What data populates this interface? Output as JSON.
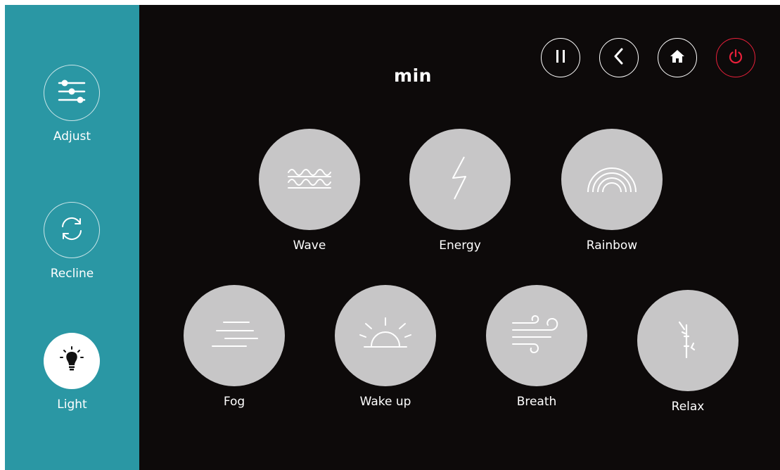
{
  "sidebar": {
    "items": [
      {
        "label": "Adjust",
        "icon": "sliders-icon",
        "active": false
      },
      {
        "label": "Recline",
        "icon": "rotate-arrows-icon",
        "active": false
      },
      {
        "label": "Light",
        "icon": "lightbulb-icon",
        "active": true
      }
    ]
  },
  "header": {
    "title": "min",
    "controls": [
      "pause-icon",
      "back-icon",
      "home-icon",
      "power-icon"
    ]
  },
  "modes": [
    {
      "label": "Wave",
      "icon": "wave-icon"
    },
    {
      "label": "Energy",
      "icon": "lightning-icon"
    },
    {
      "label": "Rainbow",
      "icon": "rainbow-icon"
    },
    {
      "label": "Fog",
      "icon": "fog-icon"
    },
    {
      "label": "Wake up",
      "icon": "sunrise-icon"
    },
    {
      "label": "Breath",
      "icon": "wind-icon"
    },
    {
      "label": "Relax",
      "icon": "bamboo-icon"
    }
  ],
  "colors": {
    "sidebar": "#2a97a4",
    "background": "#0d0a0a",
    "mode_circle": "#c7c6c7",
    "power_accent": "#e8203a"
  }
}
